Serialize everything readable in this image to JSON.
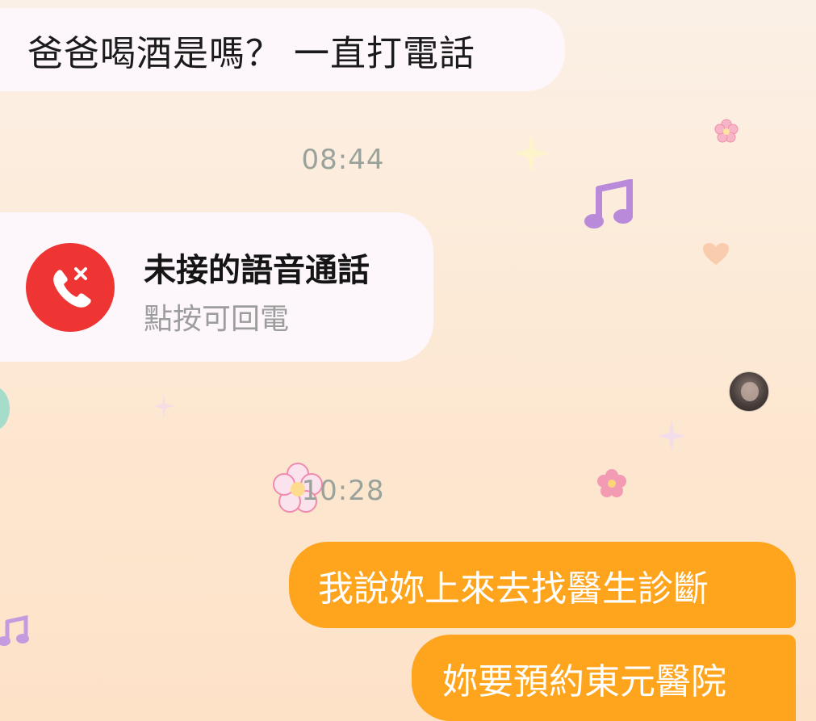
{
  "messages": {
    "incoming_1": "爸爸喝酒是嗎？ 一直打電話",
    "time_1": "08:44",
    "missed_call": {
      "title": "未接的語音通話",
      "subtitle": "點按可回電",
      "icon": "missed-call-icon"
    },
    "time_2": "10:28",
    "outgoing_1": "我說妳上來去找醫生診斷",
    "outgoing_2": "妳要預約東元醫院"
  },
  "colors": {
    "incoming_bubble": "#fdf7fc",
    "outgoing_bubble": "#fea41d",
    "missed_call_red": "#ef3434",
    "timestamp": "#9aa39b"
  },
  "decorations": [
    "flower-icon",
    "music-note-icon",
    "sparkle-icon",
    "heart-icon"
  ]
}
